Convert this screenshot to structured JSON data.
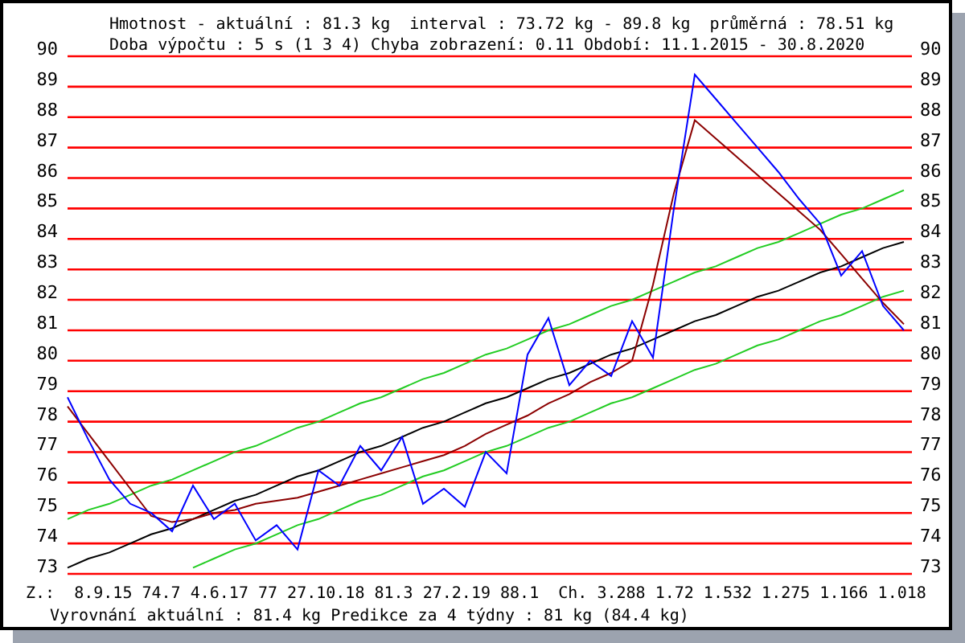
{
  "header": {
    "summary": "Hmotnost - aktuální : 81.3 kg  interval : 73.72 kg - 89.8 kg  průměrná : 78.51 kg",
    "details": "Doba výpočtu : 5 s (1 3 4) Chyba zobrazení: 0.11 Období: 11.1.2015 - 30.8.2020"
  },
  "left_axis_labels": [
    "90",
    "89",
    "88",
    "87",
    "86",
    "85",
    "84",
    "83",
    "82",
    "81",
    "80",
    "79",
    "78",
    "77",
    "76",
    "75",
    "74",
    "73"
  ],
  "right_axis_labels": [
    "90",
    "89",
    "88",
    "87",
    "86",
    "85",
    "84",
    "83",
    "82",
    "81",
    "80",
    "79",
    "78",
    "77",
    "76",
    "75",
    "74",
    "73"
  ],
  "chart_data": {
    "type": "line",
    "grid": true,
    "ylim": [
      73,
      90
    ],
    "yticks": [
      90,
      89,
      88,
      87,
      86,
      85,
      84,
      83,
      82,
      81,
      80,
      79,
      78,
      77,
      76,
      75,
      74,
      73
    ],
    "series": [
      {
        "color": "#22cc22",
        "values": [
          74.8,
          75.1,
          75.3,
          75.6,
          75.9,
          76.1,
          76.4,
          76.7,
          77.0,
          77.2,
          77.5,
          77.8,
          78.0,
          78.3,
          78.6,
          78.8,
          79.1,
          79.4,
          79.6,
          79.9,
          80.2,
          80.4,
          80.7,
          81.0,
          81.2,
          81.5,
          81.8,
          82.0,
          82.3,
          82.6,
          82.9,
          83.1,
          83.4,
          83.7,
          83.9,
          84.2,
          84.5,
          84.8,
          85.0,
          85.3,
          85.6
        ]
      },
      {
        "color": "#22cc22",
        "values": [
          null,
          null,
          null,
          null,
          null,
          null,
          73.2,
          73.5,
          73.8,
          74.0,
          74.3,
          74.6,
          74.8,
          75.1,
          75.4,
          75.6,
          75.9,
          76.2,
          76.4,
          76.7,
          77.0,
          77.2,
          77.5,
          77.8,
          78.0,
          78.3,
          78.6,
          78.8,
          79.1,
          79.4,
          79.7,
          79.9,
          80.2,
          80.5,
          80.7,
          81.0,
          81.3,
          81.5,
          81.8,
          82.1,
          82.3
        ]
      },
      {
        "color": "#000000",
        "values": [
          73.2,
          73.5,
          73.7,
          74.0,
          74.3,
          74.5,
          74.8,
          75.1,
          75.4,
          75.6,
          75.9,
          76.2,
          76.4,
          76.7,
          77.0,
          77.2,
          77.5,
          77.8,
          78.0,
          78.3,
          78.6,
          78.8,
          79.1,
          79.4,
          79.6,
          79.9,
          80.2,
          80.4,
          80.7,
          81.0,
          81.3,
          81.5,
          81.8,
          82.1,
          82.3,
          82.6,
          82.9,
          83.1,
          83.4,
          83.7,
          83.9
        ]
      },
      {
        "color": "#8b0000",
        "values": [
          78.5,
          77.6,
          76.7,
          75.8,
          74.9,
          74.7,
          74.8,
          75.0,
          75.1,
          75.3,
          75.4,
          75.5,
          75.7,
          75.9,
          76.1,
          76.3,
          76.5,
          76.7,
          76.9,
          77.2,
          77.6,
          77.9,
          78.2,
          78.6,
          78.9,
          79.3,
          79.6,
          80.0,
          82.5,
          85.5,
          87.9,
          87.3,
          86.7,
          86.1,
          85.5,
          84.9,
          84.3,
          83.5,
          82.7,
          81.9,
          81.2
        ]
      },
      {
        "color": "#0000ff",
        "values": [
          78.8,
          77.4,
          76.1,
          75.3,
          75.0,
          74.4,
          75.9,
          74.8,
          75.3,
          74.1,
          74.6,
          73.8,
          76.4,
          75.9,
          77.2,
          76.4,
          77.5,
          75.3,
          75.8,
          75.2,
          77.0,
          76.3,
          80.2,
          81.4,
          79.2,
          80.0,
          79.5,
          81.3,
          80.1,
          85.0,
          89.4,
          88.6,
          87.8,
          87.0,
          86.2,
          85.3,
          84.5,
          82.8,
          83.6,
          81.8,
          81.0
        ]
      }
    ]
  },
  "footer": {
    "extremes": "Z.:  8.9.15 74.7 4.6.17 77 27.10.18 81.3 27.2.19 88.1  Ch. 3.288 1.72 1.532 1.275 1.166 1.018",
    "smoothing": "Vyrovnání aktuální : 81.4 kg Predikce za 4 týdny : 81 kg (84.4 kg)"
  }
}
